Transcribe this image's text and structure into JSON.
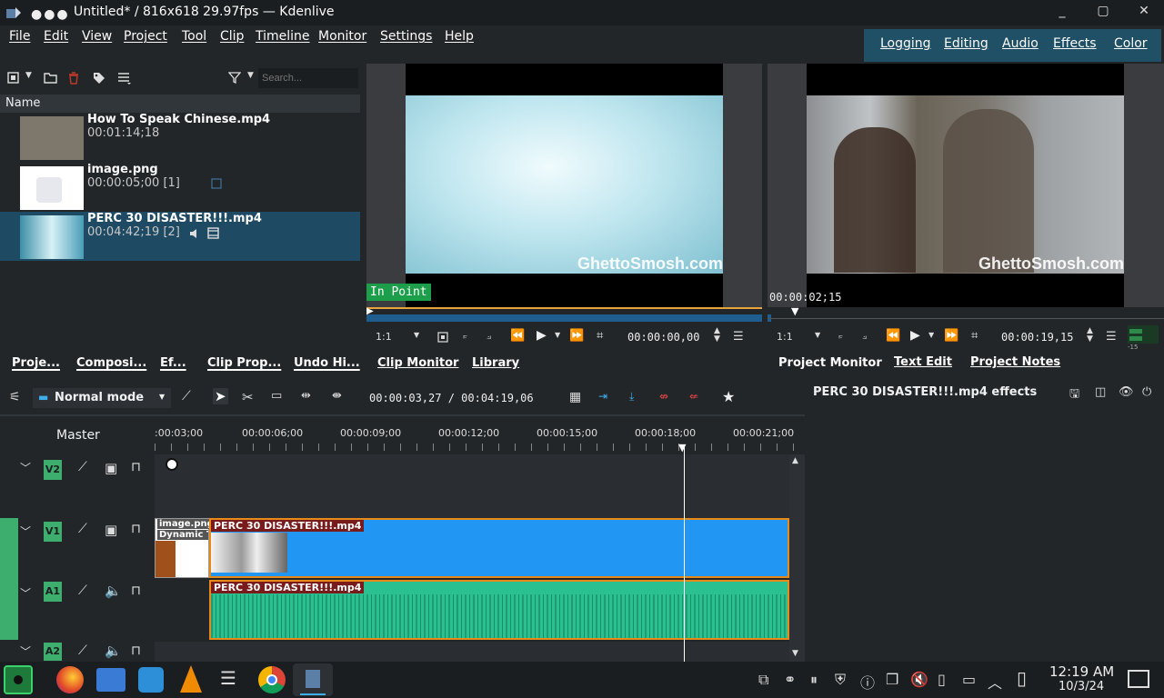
{
  "window": {
    "title": "Untitled* / 816x618 29.97fps — Kdenlive",
    "dots": "●●●"
  },
  "window_buttons": {
    "minimize": "_",
    "maximize": "▢",
    "close": "✕"
  },
  "menu": [
    "File",
    "Edit",
    "View",
    "Project",
    "Tool",
    "Clip",
    "Timeline",
    "Monitor",
    "Settings",
    "Help"
  ],
  "layouts": [
    "Logging",
    "Editing",
    "Audio",
    "Effects",
    "Color"
  ],
  "bin": {
    "search_placeholder": "Search...",
    "header": "Name",
    "items": [
      {
        "name": "How To Speak Chinese.mp4",
        "duration": "00:01:14;18"
      },
      {
        "name": "image.png",
        "duration": "00:00:05;00 [1]"
      },
      {
        "name": "PERC 30 DISASTER!!!.mp4",
        "duration": "00:04:42;19 [2]"
      }
    ]
  },
  "left_tabs": [
    "Proje...",
    "Composi...",
    "Ef...",
    "Clip Prop...",
    "Undo Hi..."
  ],
  "clip_monitor": {
    "tabs": [
      "Clip Monitor",
      "Library"
    ],
    "in_point": "In Point",
    "watermark": "GhettoSmosh.com",
    "zoom": "1:1",
    "timecode": "00:00:00,00"
  },
  "project_monitor": {
    "tabs": [
      "Project Monitor",
      "Text Edit",
      "Project Notes"
    ],
    "watermark": "GhettoSmosh.com",
    "position": "00:00:02;15",
    "zoom": "1:1",
    "timecode": "00:00:19,15",
    "level_label": "-15"
  },
  "timeline": {
    "mode": "Normal mode",
    "position": "00:00:03,27 / 00:04:19,06",
    "master": "Master",
    "ruler_ticks": [
      ":00:03;00",
      "00:00:06;00",
      "00:00:09;00",
      "00:00:12;00",
      "00:00:15;00",
      "00:00:18;00",
      "00:00:21;00"
    ],
    "tracks": [
      "V2",
      "V1",
      "A1",
      "A2"
    ],
    "clips": {
      "image_name": "image.png",
      "image_effect": "Dynamic Te",
      "video": "PERC 30 DISASTER!!!.mp4",
      "audio": "PERC 30 DISASTER!!!.mp4"
    }
  },
  "effects": {
    "title": "PERC 30 DISASTER!!!.mp4 effects"
  },
  "taskbar": {
    "time": "12:19 AM",
    "date": "10/3/24"
  },
  "colors": {
    "accent": "#3daee9",
    "track_green": "#3dae6e",
    "clip_blue": "#2196f3",
    "audio_green": "#2ac08f",
    "clip_border": "#e88a1a"
  }
}
